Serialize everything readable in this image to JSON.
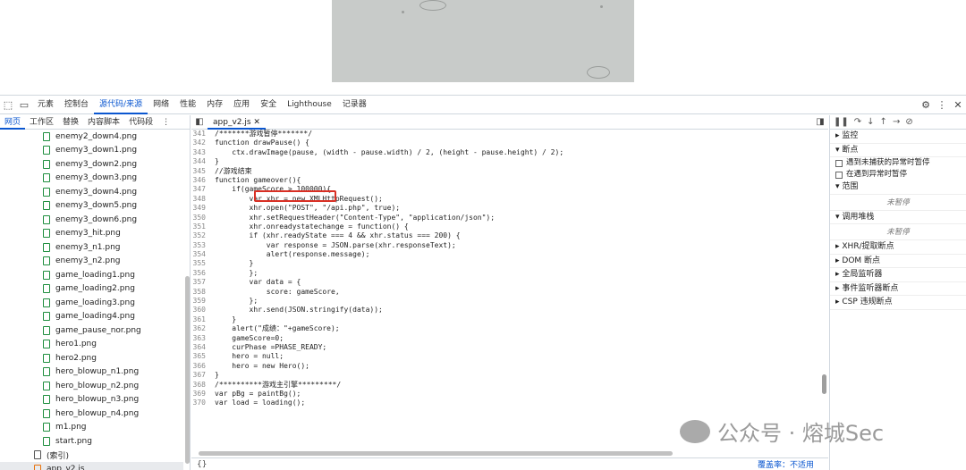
{
  "devtools_tabs": [
    "元素",
    "控制台",
    "源代码/来源",
    "网络",
    "性能",
    "内存",
    "应用",
    "安全",
    "Lighthouse",
    "记录器"
  ],
  "active_tab_index": 2,
  "left_subtabs": [
    "网页",
    "工作区",
    "替换",
    "内容脚本",
    "代码段"
  ],
  "files": [
    {
      "name": "enemy2_down4.png",
      "icon": "file-green"
    },
    {
      "name": "enemy3_down1.png",
      "icon": "file-green"
    },
    {
      "name": "enemy3_down2.png",
      "icon": "file-green"
    },
    {
      "name": "enemy3_down3.png",
      "icon": "file-green"
    },
    {
      "name": "enemy3_down4.png",
      "icon": "file-green"
    },
    {
      "name": "enemy3_down5.png",
      "icon": "file-green"
    },
    {
      "name": "enemy3_down6.png",
      "icon": "file-green"
    },
    {
      "name": "enemy3_hit.png",
      "icon": "file-green"
    },
    {
      "name": "enemy3_n1.png",
      "icon": "file-green"
    },
    {
      "name": "enemy3_n2.png",
      "icon": "file-green"
    },
    {
      "name": "game_loading1.png",
      "icon": "file-green"
    },
    {
      "name": "game_loading2.png",
      "icon": "file-green"
    },
    {
      "name": "game_loading3.png",
      "icon": "file-green"
    },
    {
      "name": "game_loading4.png",
      "icon": "file-green"
    },
    {
      "name": "game_pause_nor.png",
      "icon": "file-green"
    },
    {
      "name": "hero1.png",
      "icon": "file-green"
    },
    {
      "name": "hero2.png",
      "icon": "file-green"
    },
    {
      "name": "hero_blowup_n1.png",
      "icon": "file-green"
    },
    {
      "name": "hero_blowup_n2.png",
      "icon": "file-green"
    },
    {
      "name": "hero_blowup_n3.png",
      "icon": "file-green"
    },
    {
      "name": "hero_blowup_n4.png",
      "icon": "file-green"
    },
    {
      "name": "m1.png",
      "icon": "file-green"
    },
    {
      "name": "start.png",
      "icon": "file-green"
    },
    {
      "name": "(索引)",
      "icon": "file-grey"
    },
    {
      "name": "app_v2.js",
      "icon": "file-orange"
    }
  ],
  "editor_tab": "app_v2.js",
  "code_lines": [
    {
      "n": "341",
      "t": "/*******游戏暂停*******/"
    },
    {
      "n": "342",
      "t": "function drawPause() {"
    },
    {
      "n": "343",
      "t": "    ctx.drawImage(pause, (width - pause.width) / 2, (height - pause.height) / 2);"
    },
    {
      "n": "344",
      "t": "}"
    },
    {
      "n": "345",
      "t": "//游戏结束"
    },
    {
      "n": "346",
      "t": "function gameover(){"
    },
    {
      "n": "347",
      "t": "    if(gameScore > 100000){"
    },
    {
      "n": "348",
      "t": "        var xhr = new XMLHttpRequest();"
    },
    {
      "n": "349",
      "t": "        xhr.open(\"POST\", \"/api.php\", true);"
    },
    {
      "n": "350",
      "t": "        xhr.setRequestHeader(\"Content-Type\", \"application/json\");"
    },
    {
      "n": "351",
      "t": "        xhr.onreadystatechange = function() {"
    },
    {
      "n": "352",
      "t": "        if (xhr.readyState === 4 && xhr.status === 200) {"
    },
    {
      "n": "353",
      "t": "            var response = JSON.parse(xhr.responseText);"
    },
    {
      "n": "354",
      "t": "            alert(response.message);"
    },
    {
      "n": "355",
      "t": "        }"
    },
    {
      "n": "356",
      "t": "        };"
    },
    {
      "n": "357",
      "t": "        var data = {"
    },
    {
      "n": "358",
      "t": "            score: gameScore,"
    },
    {
      "n": "359",
      "t": "        };"
    },
    {
      "n": "360",
      "t": "        xhr.send(JSON.stringify(data));"
    },
    {
      "n": "361",
      "t": "    }"
    },
    {
      "n": "362",
      "t": "    alert(\"成绩：\"+gameScore);"
    },
    {
      "n": "363",
      "t": "    gameScore=0;"
    },
    {
      "n": "364",
      "t": "    curPhase =PHASE_READY;"
    },
    {
      "n": "365",
      "t": "    hero = null;"
    },
    {
      "n": "366",
      "t": "    hero = new Hero();"
    },
    {
      "n": "367",
      "t": "}"
    },
    {
      "n": "368",
      "t": "/**********游戏主引擎*********/"
    },
    {
      "n": "369",
      "t": "var pBg = paintBg();"
    },
    {
      "n": "370",
      "t": "var load = loading();"
    }
  ],
  "status": {
    "brace": "{}",
    "coverage": "覆盖率：不适用"
  },
  "right_panel": {
    "sections": [
      "监控",
      "断点"
    ],
    "checkboxes": [
      "遇到未捕获的异常时暂停",
      "在遇到异常时暂停"
    ],
    "scope_label": "范围",
    "scope_empty": "未暂停",
    "callstack_label": "调用堆栈",
    "callstack_empty": "未暂停",
    "more_sections": [
      "XHR/提取断点",
      "DOM 断点",
      "全局监听器",
      "事件监听器断点",
      "CSP 违规断点"
    ]
  },
  "watermark": "公众号 · 熔城Sec"
}
